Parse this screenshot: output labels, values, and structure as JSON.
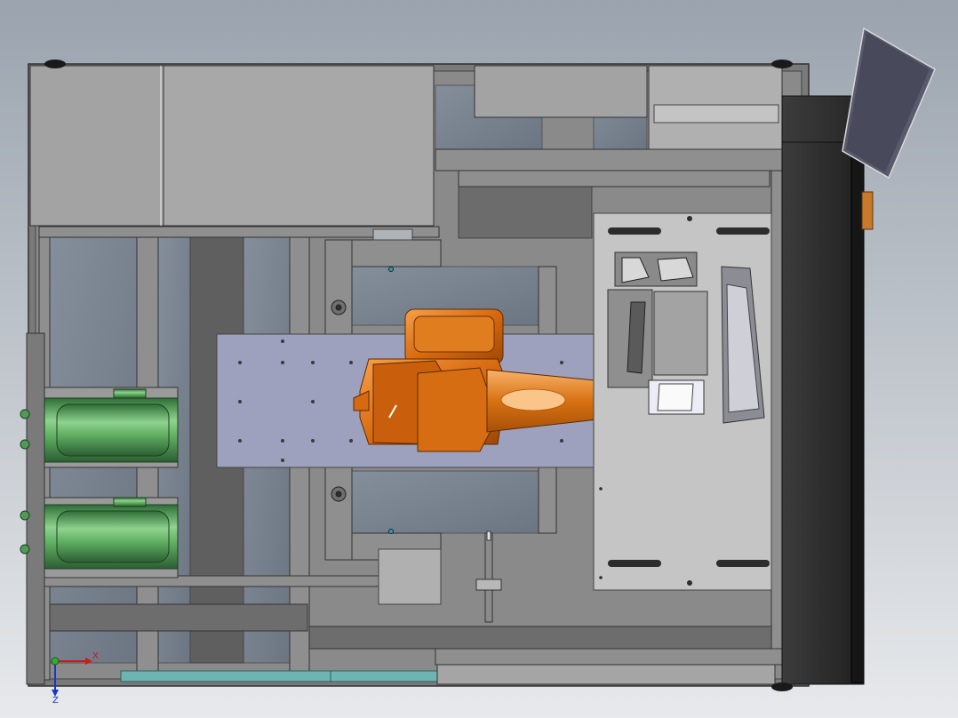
{
  "viewport": {
    "background_top": "#9aa3ae",
    "background_bottom": "#e7e9ec"
  },
  "colors": {
    "frame": "#6f6f6f",
    "panel": "#9c9c9c",
    "light_panel": "#b4b4b4",
    "dark_panel": "#5e5e5e",
    "glass": "#7d8796",
    "robot_orange": "#d56a10",
    "robot_orange_light": "#f29a3a",
    "green_cylinder": "#4f9a55",
    "teal_strip": "#6fb3b2",
    "cabinet_black": "#2a2a2a"
  },
  "triad": {
    "x_label": "X",
    "z_label": "Z",
    "icon": "axis-triad-icon"
  }
}
